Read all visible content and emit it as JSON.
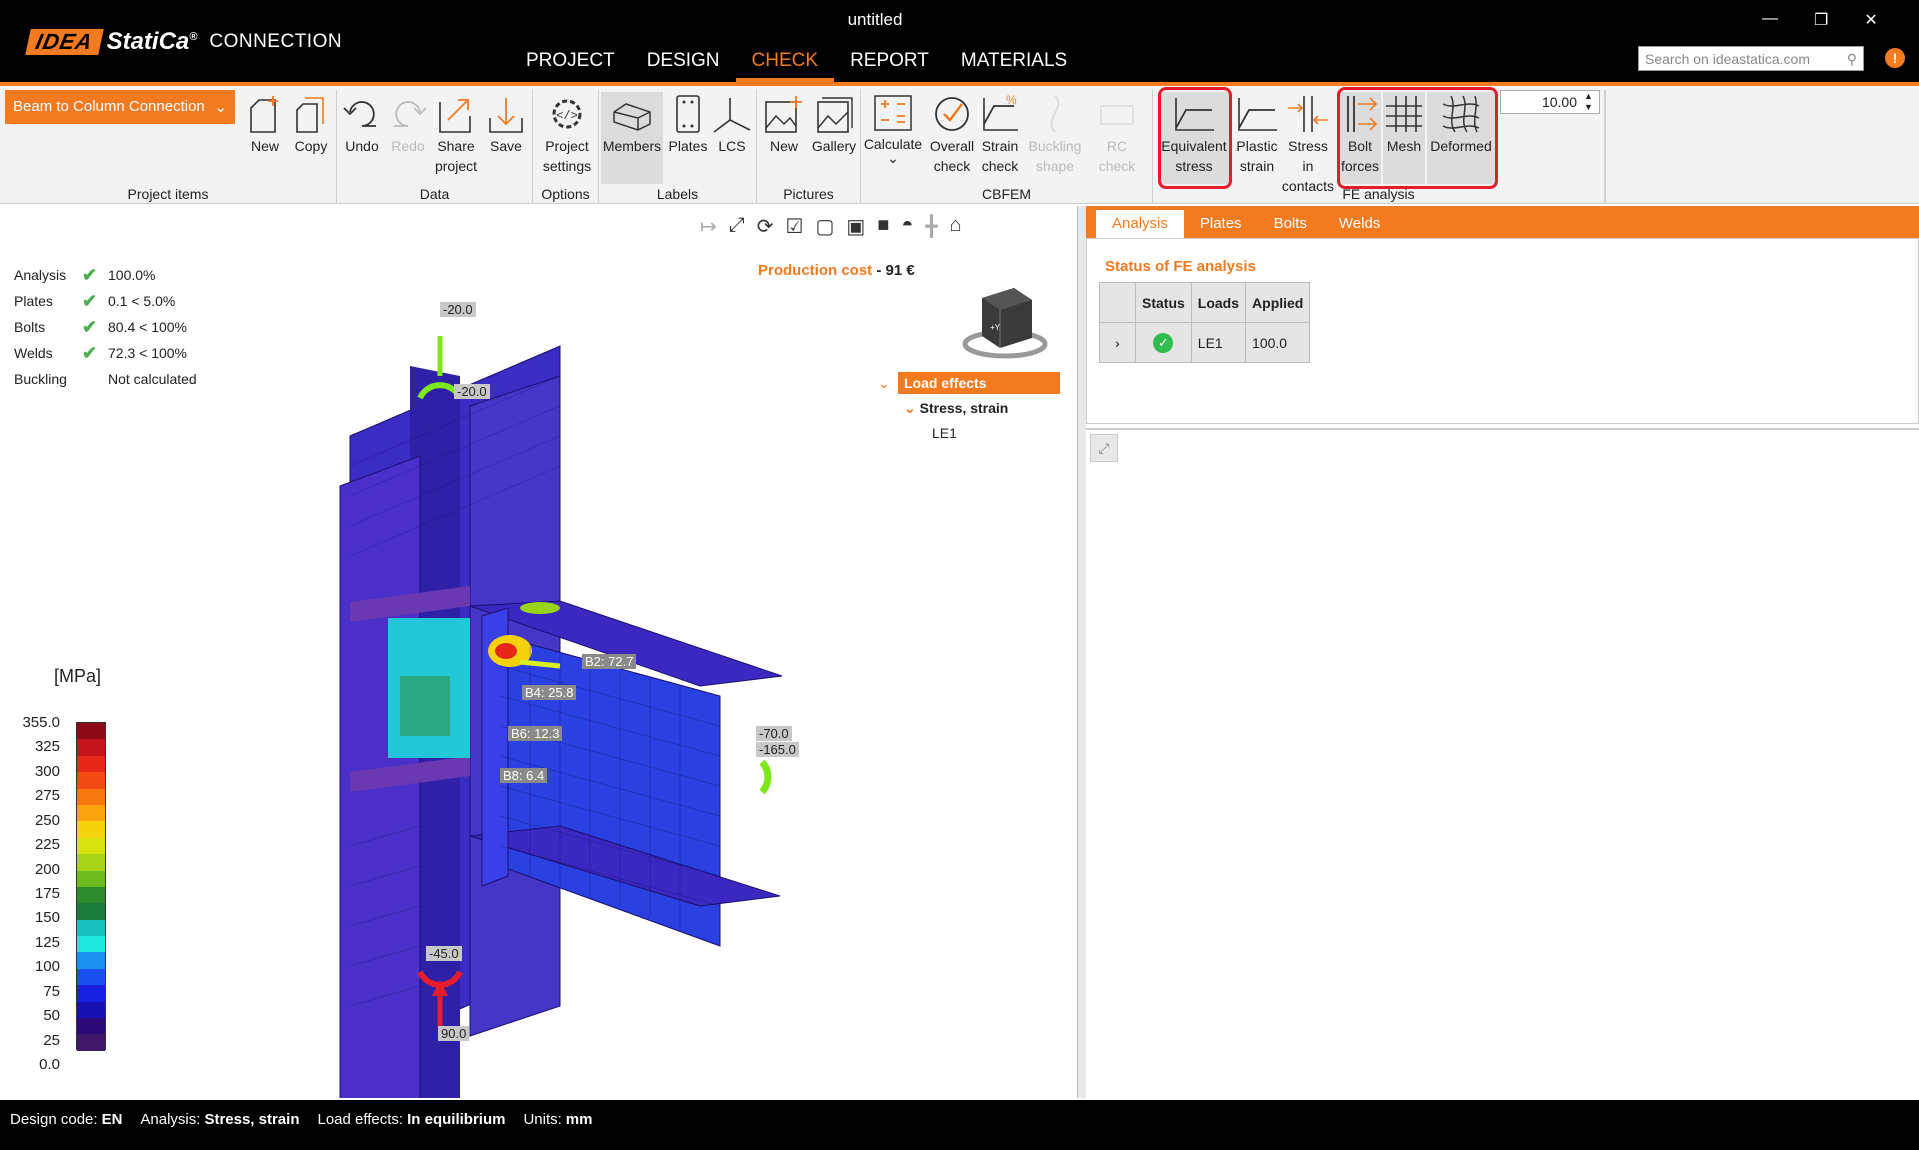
{
  "window": {
    "title": "untitled",
    "brand_idea": "IDEA",
    "brand_statica": "StatiCa",
    "brand_reg": "®",
    "product": "CONNECTION"
  },
  "menu": [
    "PROJECT",
    "DESIGN",
    "CHECK",
    "REPORT",
    "MATERIALS"
  ],
  "menu_active": "CHECK",
  "search": {
    "placeholder": "Search on ideastatica.com"
  },
  "ribbon": {
    "dropdown": "Beam to Column Connection",
    "groups": {
      "project_items": "Project items",
      "data": "Data",
      "options": "Options",
      "labels": "Labels",
      "pictures": "Pictures",
      "cbfem": "CBFEM",
      "fe_analysis": "FE analysis"
    },
    "buttons": {
      "new": "New",
      "copy": "Copy",
      "undo": "Undo",
      "redo": "Redo",
      "share": "Share project",
      "save": "Save",
      "project_settings": "Project settings",
      "members": "Members",
      "plates": "Plates",
      "lcs": "LCS",
      "pic_new": "New",
      "gallery": "Gallery",
      "calculate": "Calculate",
      "overall_check": "Overall check",
      "strain_check": "Strain check",
      "buckling_shape": "Buckling shape",
      "rc_check": "RC check",
      "equivalent_stress": "Equivalent stress",
      "plastic_strain": "Plastic strain",
      "stress_contacts": "Stress in contacts",
      "bolt_forces": "Bolt forces",
      "mesh": "Mesh",
      "deformed": "Deformed"
    },
    "deform_scale": "10.00"
  },
  "results": [
    {
      "name": "Analysis",
      "check": true,
      "value": "100.0%"
    },
    {
      "name": "Plates",
      "check": true,
      "value": "0.1 < 5.0%"
    },
    {
      "name": "Bolts",
      "check": true,
      "value": "80.4 < 100%"
    },
    {
      "name": "Welds",
      "check": true,
      "value": "72.3 < 100%"
    },
    {
      "name": "Buckling",
      "check": false,
      "value": "Not calculated"
    }
  ],
  "cost": {
    "label": "Production cost",
    "value": "91 €"
  },
  "tree": {
    "root": "Load effects",
    "child": "Stress, strain",
    "leaf": "LE1"
  },
  "legend": {
    "unit": "[MPa]",
    "values": [
      "355.0",
      "325",
      "300",
      "275",
      "250",
      "225",
      "200",
      "175",
      "150",
      "125",
      "100",
      "75",
      "50",
      "25",
      "0.0"
    ],
    "colors": [
      "#8b0a14",
      "#c4141e",
      "#e8261a",
      "#f24a12",
      "#f7780e",
      "#fba40e",
      "#f5d20c",
      "#d8e410",
      "#a8d418",
      "#6dbb1e",
      "#2d8a2a",
      "#1a7a3c",
      "#18c0c0",
      "#1fe8e0",
      "#1c90f0",
      "#1a50f0",
      "#1a20e0",
      "#1810b0",
      "#2c0a78",
      "#40186a"
    ]
  },
  "labels3d": {
    "top_force": "-20.0",
    "top_moment": "-20.0",
    "b2": "B2: 72.7",
    "b4": "B4: 25.8",
    "b6": "B6: 12.3",
    "b8": "B8: 6.4",
    "beam_force": "-70.0",
    "beam_moment": "-165.0",
    "bot_moment": "-45.0",
    "bot_force": "90.0"
  },
  "right_tabs": [
    "Analysis",
    "Plates",
    "Bolts",
    "Welds"
  ],
  "fe_status": {
    "title": "Status of FE analysis",
    "headers": [
      "Status",
      "Loads",
      "Applied"
    ],
    "row": {
      "load": "LE1",
      "applied": "100.0"
    }
  },
  "statusbar": [
    {
      "key": "Design code:",
      "value": "EN"
    },
    {
      "key": "Analysis:",
      "value": "Stress, strain"
    },
    {
      "key": "Load effects:",
      "value": "In equilibrium"
    },
    {
      "key": "Units:",
      "value": "mm"
    }
  ]
}
